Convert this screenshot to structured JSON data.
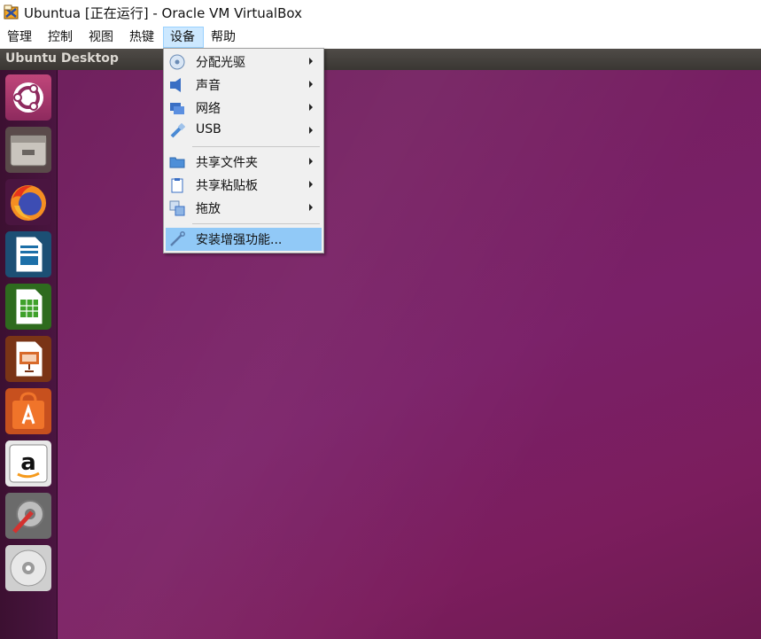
{
  "window": {
    "title": "Ubuntua [正在运行] - Oracle VM VirtualBox",
    "icon": "virtualbox-icon"
  },
  "menubar": {
    "items": [
      {
        "label": "管理"
      },
      {
        "label": "控制"
      },
      {
        "label": "视图"
      },
      {
        "label": "热键"
      },
      {
        "label": "设备",
        "active": true
      },
      {
        "label": "帮助"
      }
    ]
  },
  "vm_header": {
    "label": "Ubuntu Desktop"
  },
  "launcher": {
    "items": [
      {
        "name": "ubuntu-dash-icon"
      },
      {
        "name": "files-icon"
      },
      {
        "name": "firefox-icon"
      },
      {
        "name": "libreoffice-writer-icon"
      },
      {
        "name": "libreoffice-calc-icon"
      },
      {
        "name": "libreoffice-impress-icon"
      },
      {
        "name": "ubuntu-software-icon"
      },
      {
        "name": "amazon-icon"
      },
      {
        "name": "system-settings-icon"
      },
      {
        "name": "dvd-icon"
      }
    ]
  },
  "devices_menu": {
    "items": [
      {
        "label": "分配光驱",
        "icon": "optical-drive-icon",
        "submenu": true
      },
      {
        "label": "声音",
        "icon": "audio-icon",
        "submenu": true
      },
      {
        "label": "网络",
        "icon": "network-icon",
        "submenu": true
      },
      {
        "label": "USB",
        "icon": "usb-icon",
        "submenu": true
      },
      {
        "label": "共享文件夹",
        "icon": "shared-folder-icon",
        "submenu": true
      },
      {
        "label": "共享粘贴板",
        "icon": "shared-clipboard-icon",
        "submenu": true
      },
      {
        "label": "拖放",
        "icon": "drag-drop-icon",
        "submenu": true
      },
      {
        "label": "安装增强功能...",
        "icon": "guest-additions-icon",
        "submenu": false,
        "highlighted": true
      }
    ]
  },
  "colors": {
    "desktop": "#761f62",
    "launcher": "#431236",
    "menu_highlight": "#91c9f7",
    "menubar_active": "#cce8ff"
  }
}
